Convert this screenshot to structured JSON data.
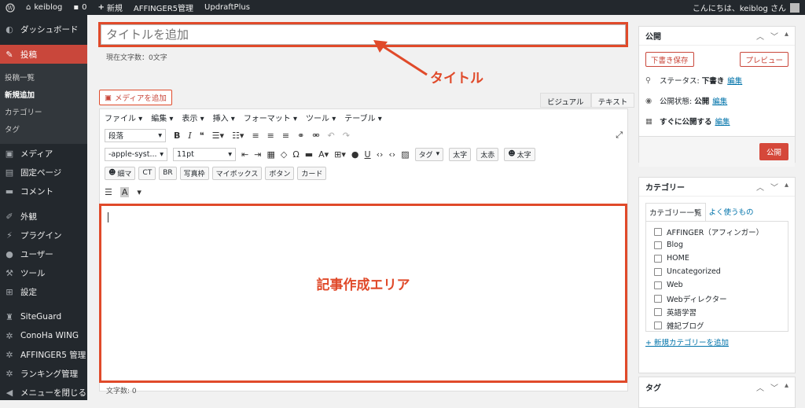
{
  "adminbar": {
    "site_name": "keiblog",
    "comments_count": "0",
    "new_label": "新規",
    "affinger_label": "AFFINGER5管理",
    "updraft_label": "UpdraftPlus",
    "greeting": "こんにちは、keiblog さん"
  },
  "sidebar": {
    "dashboard": "ダッシュボード",
    "posts": "投稿",
    "submenu": [
      "投稿一覧",
      "新規追加",
      "カテゴリー",
      "タグ"
    ],
    "media": "メディア",
    "pages": "固定ページ",
    "comments": "コメント",
    "appearance": "外観",
    "plugins": "プラグイン",
    "users": "ユーザー",
    "tools": "ツール",
    "settings": "設定",
    "siteguard": "SiteGuard",
    "conoha": "ConoHa WING",
    "affinger": "AFFINGER5 管理",
    "ranking": "ランキング管理",
    "collapse": "メニューを閉じる"
  },
  "editor": {
    "title_placeholder": "タイトルを追加",
    "char_count": "現在文字数：0文字",
    "annotation_title": "タイトル",
    "add_media": "メディアを追加",
    "tab_visual": "ビジュアル",
    "tab_text": "テキスト",
    "menubar": [
      "ファイル ▾",
      "編集 ▾",
      "表示 ▾",
      "挿入 ▾",
      "フォーマット ▾",
      "ツール ▾",
      "テーブル ▾"
    ],
    "format_select": "段落",
    "font_select": "-apple-syst...",
    "size_select": "11pt",
    "tag_select": "タグ",
    "buttons_row2": [
      "太字",
      "太赤"
    ],
    "button_hoso": "細マ",
    "button_futo": "太字",
    "buttons_row3": [
      "CT",
      "BR",
      "写真枠",
      "マイボックス",
      "ボタン",
      "カード"
    ],
    "annotation_body": "記事作成エリア",
    "word_count": "文字数: 0"
  },
  "publish": {
    "title": "公開",
    "save_draft": "下書き保存",
    "preview": "プレビュー",
    "status_label": "ステータス:",
    "status_value": "下書き",
    "visibility_label": "公開状態:",
    "visibility_value": "公開",
    "schedule_label": "すぐに公開する",
    "edit": "編集",
    "publish_button": "公開"
  },
  "categories": {
    "title": "カテゴリー",
    "tab_all": "カテゴリー一覧",
    "tab_popular": "よく使うもの",
    "items": [
      "AFFINGER（アフィンガー）",
      "Blog",
      "HOME",
      "Uncategorized",
      "Web",
      "Webディレクター",
      "英語学習",
      "雑記ブログ"
    ],
    "add_new": "+ 新規カテゴリーを追加"
  },
  "tags": {
    "title": "タグ"
  },
  "colors": {
    "accent": "#e04a2a",
    "admin_dark": "#23282d",
    "link": "#0073aa"
  }
}
